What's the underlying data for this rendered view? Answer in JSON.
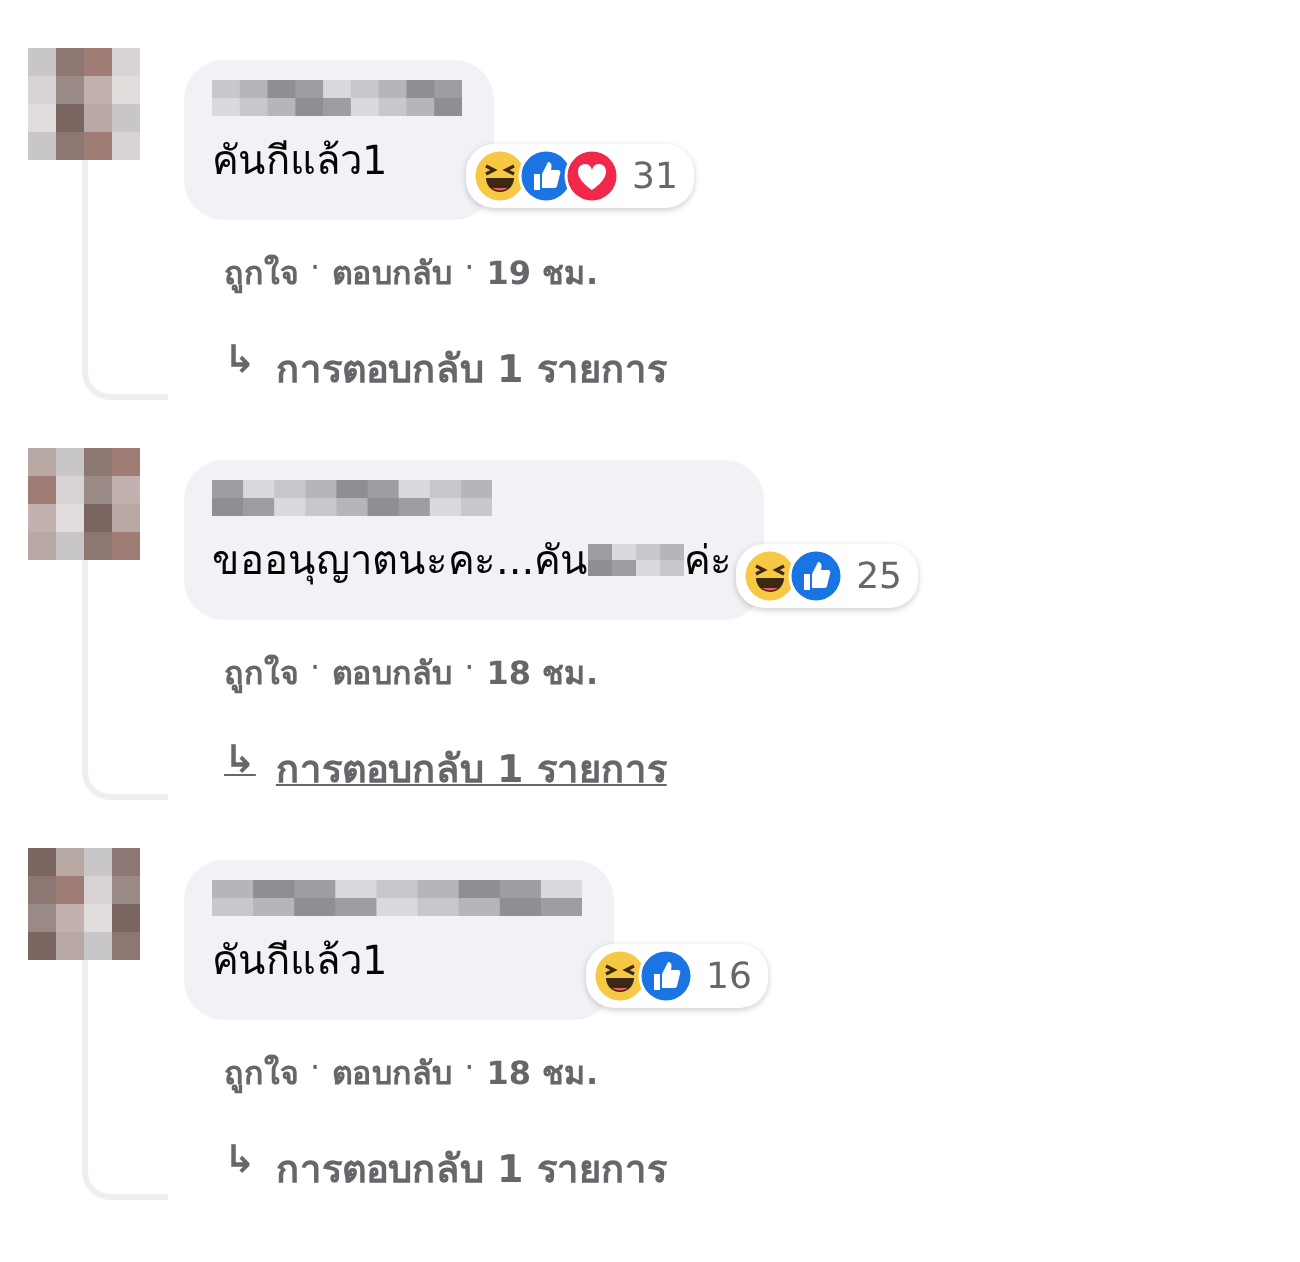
{
  "comments": [
    {
      "text": "คันกีแล้ว1",
      "reactions": [
        {
          "kind": "haha"
        },
        {
          "kind": "like"
        },
        {
          "kind": "love"
        }
      ],
      "reaction_count": "31",
      "actions": [
        "ถูกใจ",
        "ตอบกลับ",
        "19 ชม."
      ],
      "separator": "·",
      "replies": {
        "arrow": "↳",
        "label": "การตอบกลับ 1 รายการ",
        "underlined": false
      }
    },
    {
      "text": "ขออนุญาตนะคะ...คัน",
      "text_end": "ค่ะ",
      "reactions": [
        {
          "kind": "haha"
        },
        {
          "kind": "like"
        }
      ],
      "reaction_count": "25",
      "actions": [
        "ถูกใจ",
        "ตอบกลับ",
        "18 ชม."
      ],
      "separator": "·",
      "replies": {
        "arrow": "↳",
        "label": "การตอบกลับ 1 รายการ",
        "underlined": true
      }
    },
    {
      "text": "คันกีแล้ว1",
      "reactions": [
        {
          "kind": "haha"
        },
        {
          "kind": "like"
        }
      ],
      "reaction_count": "16",
      "actions": [
        "ถูกใจ",
        "ตอบกลับ",
        "18 ชม."
      ],
      "separator": "·",
      "replies": {
        "arrow": "↳",
        "label": "การตอบกลับ 1 รายการ",
        "underlined": false
      }
    }
  ]
}
